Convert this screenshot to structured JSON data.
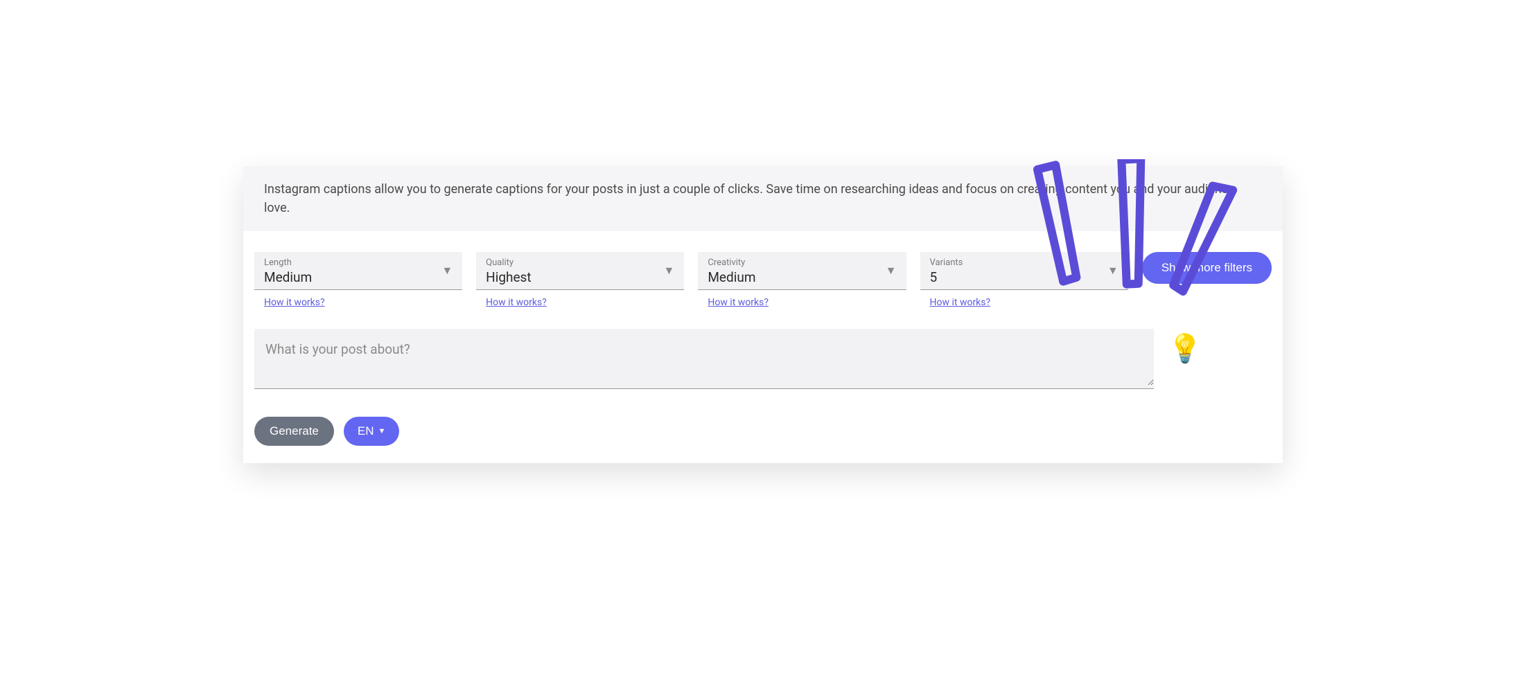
{
  "banner": {
    "text": "Instagram captions allow you to generate captions for your posts in just a couple of clicks. Save time on researching ideas and focus on creating content you and your audience love."
  },
  "filters": {
    "length": {
      "label": "Length",
      "value": "Medium",
      "help": "How it works?"
    },
    "quality": {
      "label": "Quality",
      "value": "Highest",
      "help": "How it works?"
    },
    "creativity": {
      "label": "Creativity",
      "value": "Medium",
      "help": "How it works?"
    },
    "variants": {
      "label": "Variants",
      "value": "5",
      "help": "How it works?"
    },
    "show_more_label": "Show more filters"
  },
  "input": {
    "placeholder": "What is your post about?",
    "value": ""
  },
  "actions": {
    "generate_label": "Generate",
    "language_label": "EN"
  },
  "icons": {
    "lightbulb": "💡"
  },
  "colors": {
    "accent": "#6366f1",
    "decoration": "#5b4cd8"
  }
}
